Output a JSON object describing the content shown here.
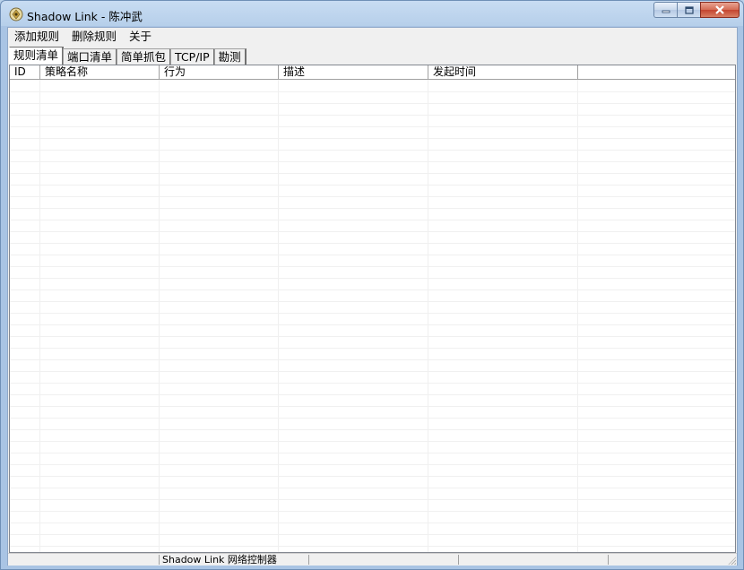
{
  "window": {
    "title": "Shadow Link - 陈冲武",
    "icon": "app-icon"
  },
  "menu": [
    "添加规则",
    "删除规则",
    "关于"
  ],
  "tabs": [
    {
      "label": "规则清单",
      "active": true
    },
    {
      "label": "端口清单",
      "active": false
    },
    {
      "label": "简单抓包",
      "active": false
    },
    {
      "label": "TCP/IP",
      "active": false
    },
    {
      "label": "勘测",
      "active": false
    }
  ],
  "table": {
    "columns": [
      "ID",
      "策略名称",
      "行为",
      "描述",
      "发起时间",
      ""
    ],
    "rows": []
  },
  "statusbar": {
    "panes": [
      "",
      "Shadow Link 网络控制器",
      "",
      "",
      ""
    ]
  },
  "colors": {
    "titlebar": "#b9d1ea",
    "close_button": "#c44530",
    "client_bg": "#f0f0f0",
    "list_bg": "#ffffff"
  }
}
